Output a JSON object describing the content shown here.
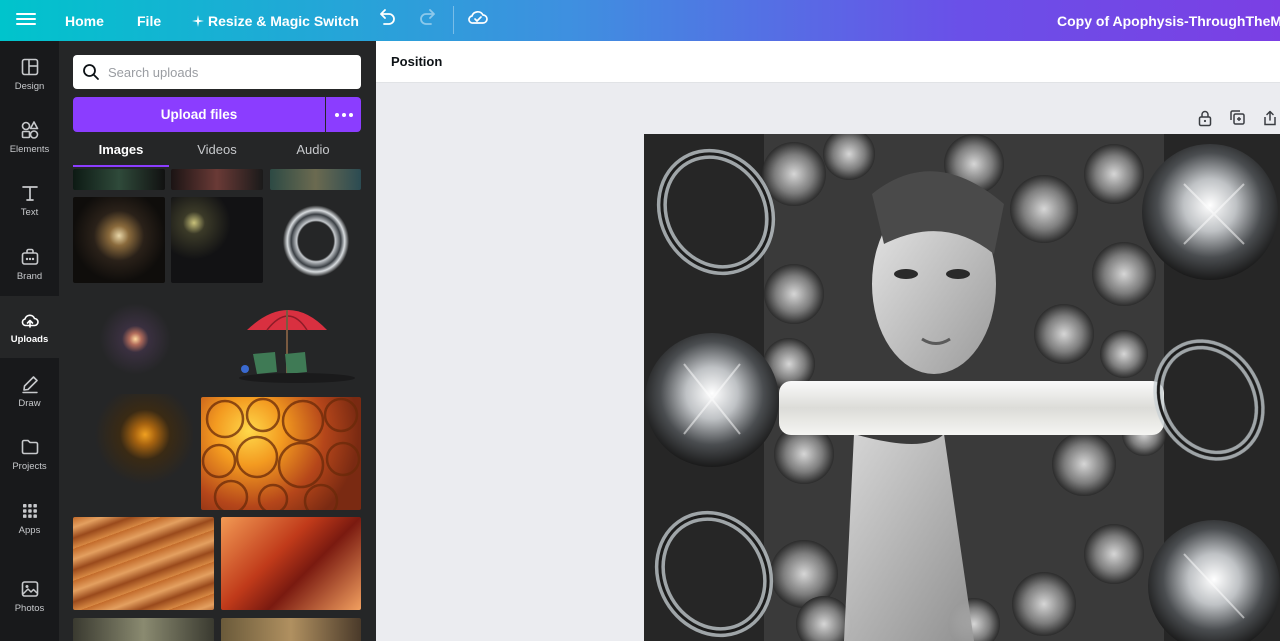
{
  "topbar": {
    "home": "Home",
    "file": "File",
    "resize": "Resize & Magic Switch",
    "doc_title": "Copy of Apophysis-ThroughTheMirror"
  },
  "rail": {
    "items": [
      {
        "label": "Design",
        "icon": "layout-icon"
      },
      {
        "label": "Elements",
        "icon": "shapes-icon"
      },
      {
        "label": "Text",
        "icon": "text-icon"
      },
      {
        "label": "Brand",
        "icon": "brand-kit-icon"
      },
      {
        "label": "Uploads",
        "icon": "cloud-upload-icon"
      },
      {
        "label": "Draw",
        "icon": "pen-icon"
      },
      {
        "label": "Projects",
        "icon": "folder-icon"
      },
      {
        "label": "Apps",
        "icon": "grid-icon"
      },
      {
        "label": "Photos",
        "icon": "image-icon"
      }
    ],
    "active": "Uploads"
  },
  "panel": {
    "search_placeholder": "Search uploads",
    "upload_label": "Upload files",
    "tabs": [
      "Images",
      "Videos",
      "Audio"
    ],
    "active_tab": "Images"
  },
  "toolbar": {
    "position_label": "Position"
  },
  "colors": {
    "brand_purple": "#8b3dff",
    "rail_bg": "#18191b",
    "panel_bg": "#252627"
  }
}
